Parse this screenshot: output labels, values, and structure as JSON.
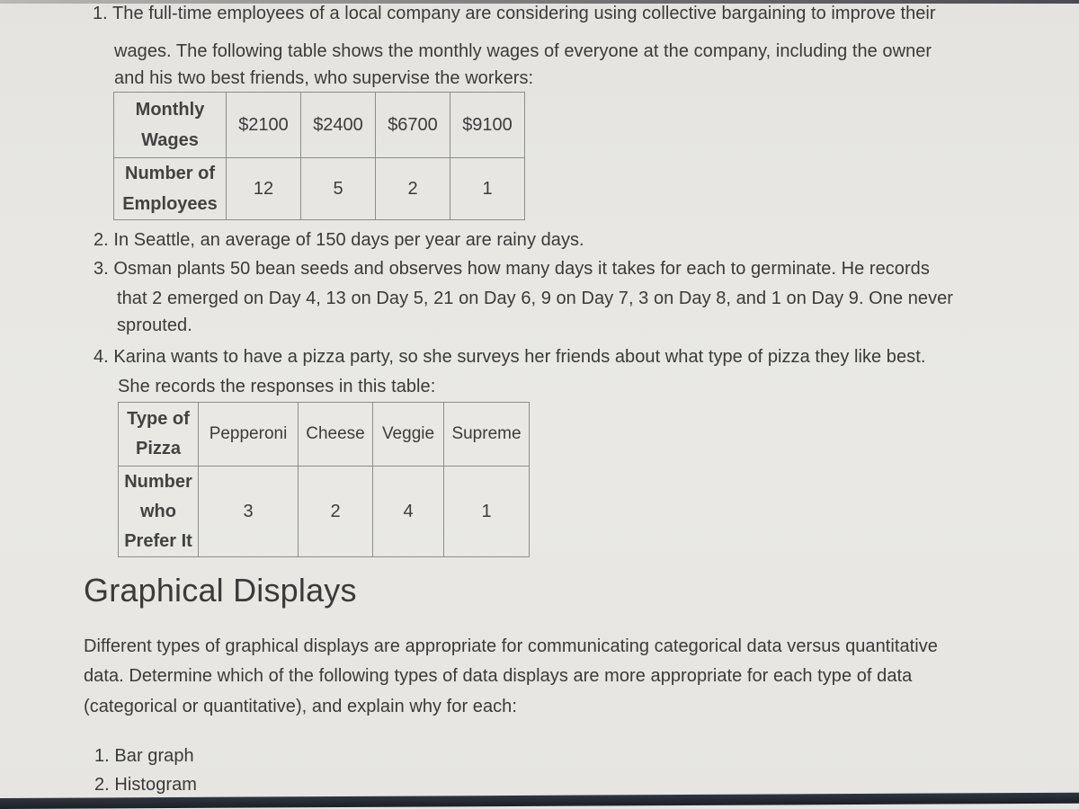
{
  "questions": [
    {
      "number": "1.",
      "lines": [
        "The full-time employees of a local company are considering using collective bargaining to improve their",
        "wages. The following table shows the monthly wages of everyone at the company, including the owner",
        "and his two best friends, who supervise the workers:"
      ],
      "table": {
        "row_headers": [
          "Monthly Wages",
          "Number of Employees"
        ],
        "row_header_lines": [
          [
            "Monthly",
            "Wages"
          ],
          [
            "Number of",
            "Employees"
          ]
        ],
        "columns": [
          {
            "wage": "$2100",
            "employees": "12"
          },
          {
            "wage": "$2400",
            "employees": "5"
          },
          {
            "wage": "$6700",
            "employees": "2"
          },
          {
            "wage": "$9100",
            "employees": "1"
          }
        ]
      }
    },
    {
      "number": "2.",
      "lines": [
        "In Seattle, an average of 150 days per year are rainy days."
      ]
    },
    {
      "number": "3.",
      "lines": [
        "Osman plants 50 bean seeds and observes how many days it takes for each to germinate. He records",
        "that 2 emerged on Day 4, 13 on Day 5, 21 on Day 6, 9 on Day 7, 3 on Day 8, and 1 on Day 9. One never",
        "sprouted."
      ]
    },
    {
      "number": "4.",
      "lines": [
        "Karina wants to have a pizza party, so she surveys her friends about what type of pizza they like best.",
        "She records the responses in this table:"
      ],
      "table": {
        "row_headers": [
          "Type of Pizza",
          "Number who Prefer It"
        ],
        "row_header_lines": [
          [
            "Type of",
            "Pizza"
          ],
          [
            "Number",
            "who",
            "Prefer It"
          ]
        ],
        "columns": [
          {
            "type": "Pepperoni",
            "count": "3"
          },
          {
            "type": "Cheese",
            "count": "2"
          },
          {
            "type": "Veggie",
            "count": "4"
          },
          {
            "type": "Supreme",
            "count": "1"
          }
        ]
      }
    }
  ],
  "section": {
    "heading": "Graphical Displays",
    "paragraph_lines": [
      "Different types of graphical displays are appropriate for communicating categorical data versus quantitative",
      "data. Determine which of the following types of data displays are more appropriate for each type of data",
      "(categorical or quantitative), and explain why for each:"
    ],
    "list": [
      {
        "number": "1.",
        "label": "Bar graph"
      },
      {
        "number": "2.",
        "label": "Histogram"
      }
    ]
  }
}
